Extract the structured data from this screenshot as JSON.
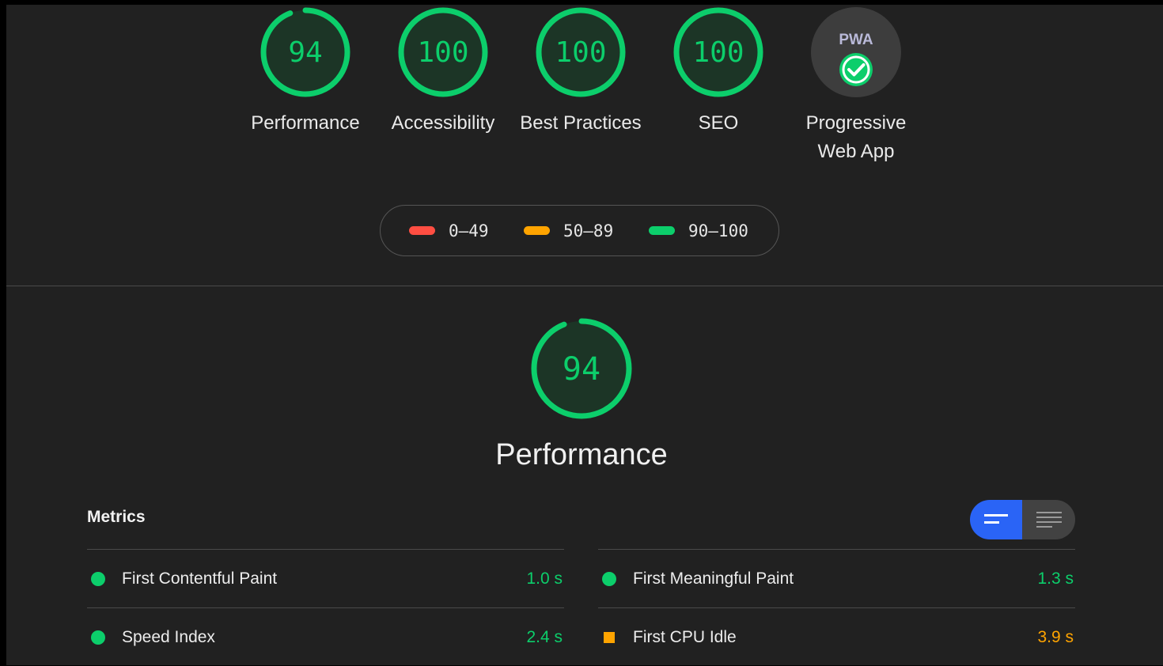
{
  "colors": {
    "pass": "#0cce6b",
    "average": "#ffa400",
    "fail": "#ff4e42",
    "gauge_track": "#1c3526",
    "pwa_bg": "#3d3d3d",
    "toggle_active": "#2a64f6"
  },
  "scores": [
    {
      "value": "94",
      "label": "Performance",
      "score": 0.94
    },
    {
      "value": "100",
      "label": "Accessibility",
      "score": 1.0
    },
    {
      "value": "100",
      "label": "Best Practices",
      "score": 1.0
    },
    {
      "value": "100",
      "label": "SEO",
      "score": 1.0
    },
    {
      "value": "PWA",
      "label": "Progressive Web App",
      "icon": "check-badge-icon"
    }
  ],
  "legend": [
    {
      "range": "0–49",
      "color": "#ff4e42"
    },
    {
      "range": "50–89",
      "color": "#ffa400"
    },
    {
      "range": "90–100",
      "color": "#0cce6b"
    }
  ],
  "performance": {
    "score": "94",
    "score_fraction": 0.94,
    "title": "Performance",
    "metrics_title": "Metrics",
    "view_toggle": {
      "active": "list-summary-icon",
      "inactive": "list-detail-icon"
    },
    "metrics": [
      {
        "label": "First Contentful Paint",
        "value": "1.0 s",
        "status": "pass"
      },
      {
        "label": "First Meaningful Paint",
        "value": "1.3 s",
        "status": "pass"
      },
      {
        "label": "Speed Index",
        "value": "2.4 s",
        "status": "pass"
      },
      {
        "label": "First CPU Idle",
        "value": "3.9 s",
        "status": "average"
      }
    ]
  }
}
